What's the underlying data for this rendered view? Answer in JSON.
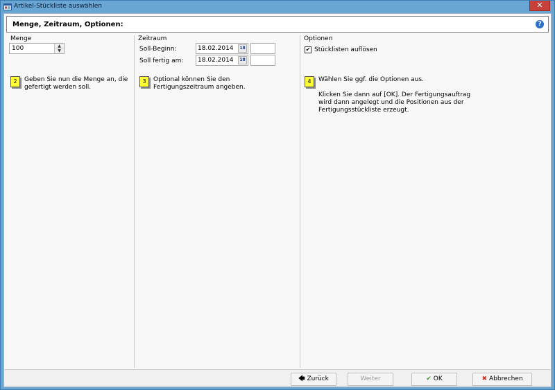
{
  "window": {
    "title": "Artikel-Stückliste auswählen",
    "close_glyph": "✕"
  },
  "header": {
    "title": "Menge, Zeitraum, Optionen:",
    "help_glyph": "?"
  },
  "menge": {
    "label": "Menge",
    "value": "100",
    "up_glyph": "▲",
    "down_glyph": "▼"
  },
  "zeitraum": {
    "label": "Zeitraum",
    "start_label": "Soll-Beginn:",
    "start_date": "18.02.2014",
    "end_label": "Soll fertig am:",
    "end_date": "18.02.2014",
    "cal_glyph": "18"
  },
  "optionen": {
    "label": "Optionen",
    "checkbox_label": "Stücklisten auflösen",
    "checkbox_checked": true,
    "check_glyph": "✔"
  },
  "hints": [
    {
      "number": "2",
      "text_line1": "Geben Sie nun die Menge an, die",
      "text_line2": "gefertigt  werden soll."
    },
    {
      "number": "3",
      "text_line1": "Optional können Sie den",
      "text_line2": "Fertigungszeitraum angeben."
    },
    {
      "number": "4",
      "text_line1": "Wählen Sie ggf. die Optionen aus.",
      "text_line2": "Klicken Sie dann auf [OK]. Der Fertigungsauftrag",
      "text_line3": "wird dann angelegt und die Positionen aus der",
      "text_line4": "Fertigungsstückliste erzeugt."
    }
  ],
  "footer": {
    "back_label": "Zurück",
    "back_glyph": "🡄",
    "next_label": "Weiter",
    "ok_label": "OK",
    "ok_glyph": "✔",
    "cancel_label": "Abbrechen",
    "cancel_glyph": "✖"
  },
  "colors": {
    "frame": "#6aa6d4",
    "close": "#c7403a",
    "badge": "#ffff33",
    "ok_icon": "#3a9a2a",
    "cancel_icon": "#d03020"
  },
  "icons": {
    "app": "app-window-icon",
    "help": "help-icon",
    "calendar": "calendar-icon"
  }
}
